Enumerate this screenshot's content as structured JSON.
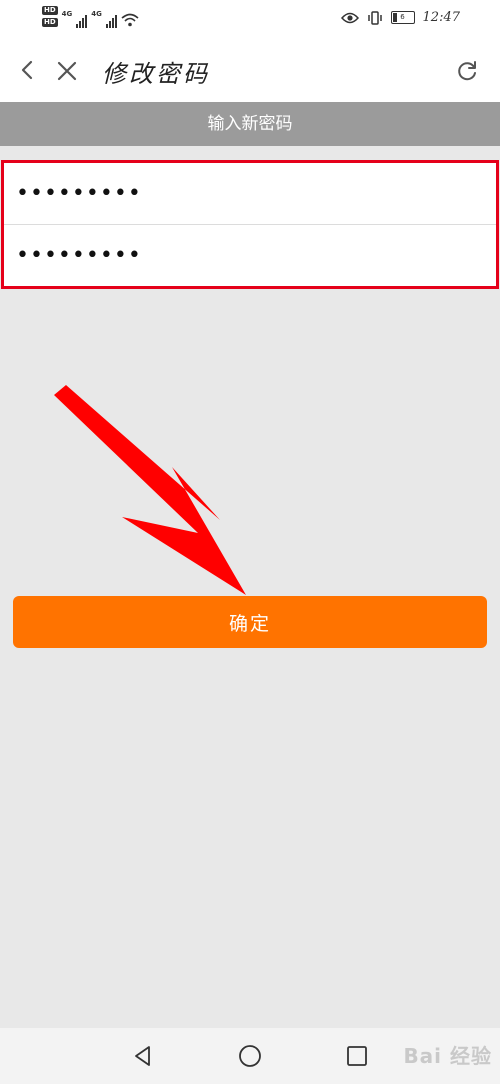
{
  "status_bar": {
    "hd_badge_1": "HD",
    "hd_badge_2": "HD",
    "network_1": "4G",
    "network_2": "4G",
    "battery": "6",
    "time": "12:47"
  },
  "app_bar": {
    "title": "修改密码"
  },
  "section": {
    "header": "输入新密码"
  },
  "form": {
    "new_password_value": "•••••••••",
    "confirm_password_value": "•••••••••",
    "submit_label": "确定"
  },
  "watermark": {
    "text": "Bai 经验"
  },
  "colors": {
    "accent": "#ff7300",
    "highlight_border": "#e5001a",
    "header_bg": "#9b9b9b",
    "page_bg": "#e8e8e8"
  }
}
